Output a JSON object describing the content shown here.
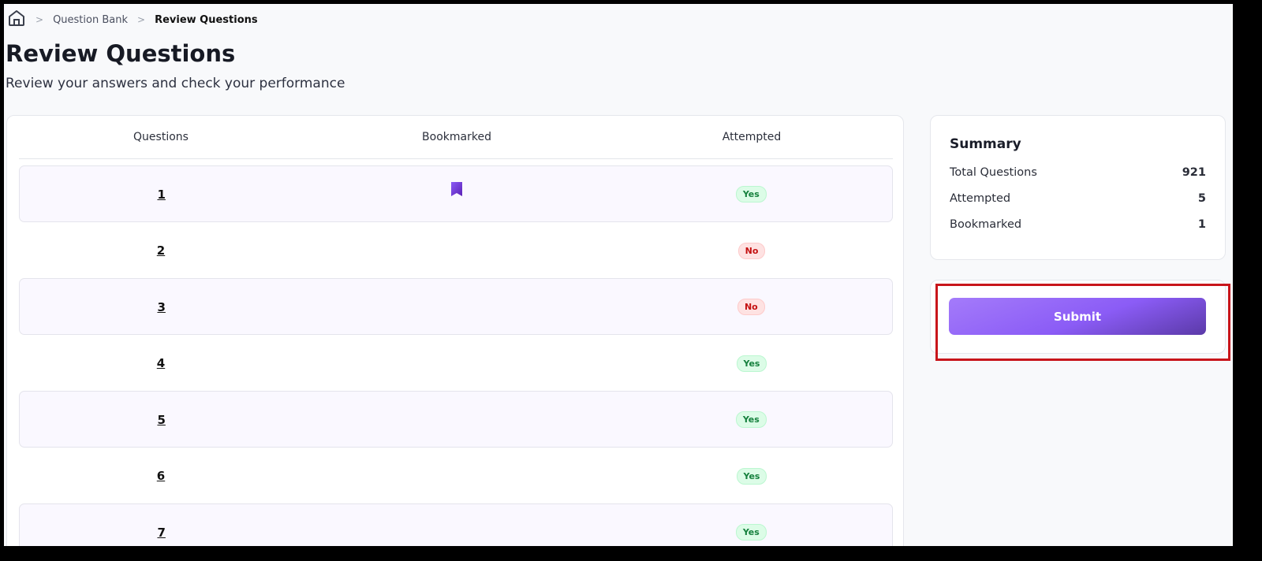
{
  "breadcrumb": {
    "items": [
      "Question Bank",
      "Review Questions"
    ]
  },
  "page": {
    "title": "Review Questions",
    "subtitle": "Review your answers and check your performance"
  },
  "table": {
    "headers": [
      "Questions",
      "Bookmarked",
      "Attempted"
    ],
    "rows": [
      {
        "number": "1",
        "bookmarked": true,
        "attempted": "Yes"
      },
      {
        "number": "2",
        "bookmarked": false,
        "attempted": "No"
      },
      {
        "number": "3",
        "bookmarked": false,
        "attempted": "No"
      },
      {
        "number": "4",
        "bookmarked": false,
        "attempted": "Yes"
      },
      {
        "number": "5",
        "bookmarked": false,
        "attempted": "Yes"
      },
      {
        "number": "6",
        "bookmarked": false,
        "attempted": "Yes"
      },
      {
        "number": "7",
        "bookmarked": false,
        "attempted": "Yes"
      }
    ]
  },
  "summary": {
    "title": "Summary",
    "items": [
      {
        "label": "Total Questions",
        "value": "921"
      },
      {
        "label": "Attempted",
        "value": "5"
      },
      {
        "label": "Bookmarked",
        "value": "1"
      }
    ]
  },
  "actions": {
    "submit_label": "Submit"
  },
  "colors": {
    "accent": "#8b5cf6",
    "yes": "#15803d",
    "no": "#c41010",
    "highlight": "#c8151b"
  }
}
